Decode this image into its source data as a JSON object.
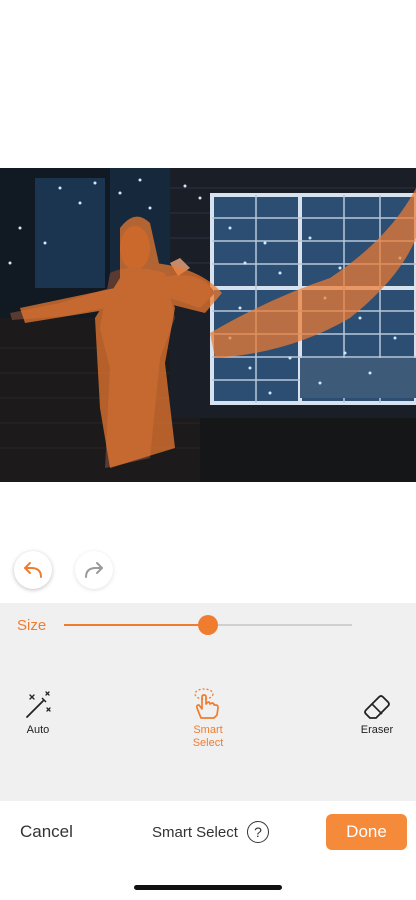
{
  "editor": {
    "photo_alt": "photo being edited with orange selection mask"
  },
  "history": {
    "undo_icon": "undo-arrow-icon",
    "redo_icon": "redo-arrow-icon"
  },
  "size_control": {
    "label": "Size",
    "value_fraction": 0.5
  },
  "tools": [
    {
      "label": "Auto",
      "icon": "magic-wand-icon",
      "active": false
    },
    {
      "label": "Smart Select",
      "label_line1": "Smart",
      "label_line2": "Select",
      "icon": "hand-select-icon",
      "active": true
    },
    {
      "label": "Eraser",
      "icon": "eraser-icon",
      "active": false
    }
  ],
  "bottom_bar": {
    "cancel_label": "Cancel",
    "mode_title": "Smart Select",
    "help_label": "?",
    "done_label": "Done"
  },
  "colors": {
    "accent": "#f07c30",
    "done_button": "#f58a3a",
    "panel_bg": "#f0f0f0"
  }
}
